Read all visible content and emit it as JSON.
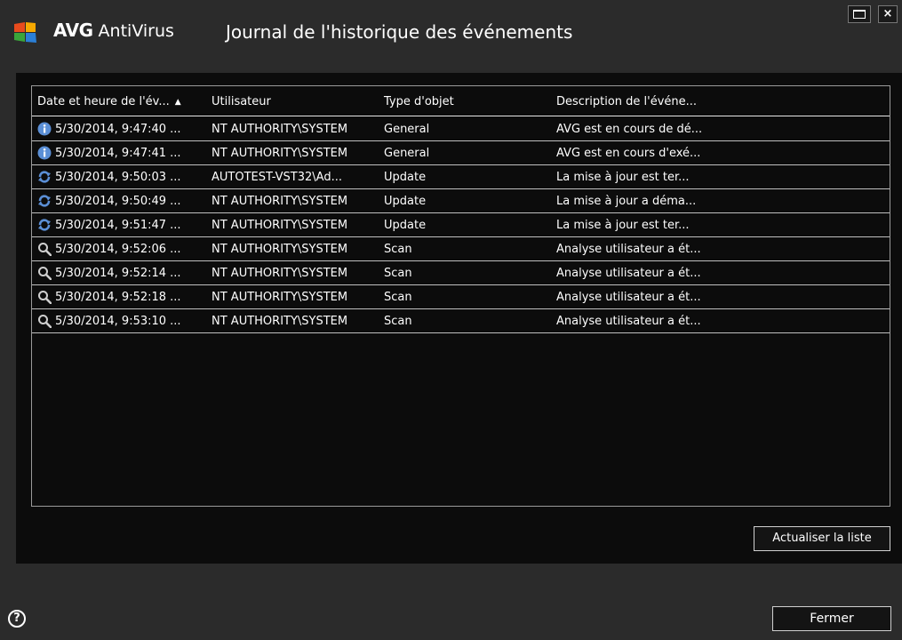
{
  "window": {
    "brand_bold": "AVG",
    "brand_rest": " AntiVirus",
    "title": "Journal de l'historique des événements",
    "close_glyph": "×"
  },
  "table": {
    "columns": [
      "Date et heure de l'év...",
      "Utilisateur",
      "Type d'objet",
      "Description de l'événe..."
    ],
    "sort_glyph": "▲",
    "rows": [
      {
        "icon": "info-icon",
        "date": "5/30/2014, 9:47:40 ...",
        "user": "NT AUTHORITY\\SYSTEM",
        "type": "General",
        "desc": "AVG est en cours de dé..."
      },
      {
        "icon": "info-icon",
        "date": "5/30/2014, 9:47:41 ...",
        "user": "NT AUTHORITY\\SYSTEM",
        "type": "General",
        "desc": "AVG est en cours d'exé..."
      },
      {
        "icon": "update-icon",
        "date": "5/30/2014, 9:50:03 ...",
        "user": "AUTOTEST-VST32\\Ad...",
        "type": "Update",
        "desc": "La mise à jour est ter..."
      },
      {
        "icon": "update-icon",
        "date": "5/30/2014, 9:50:49 ...",
        "user": "NT AUTHORITY\\SYSTEM",
        "type": "Update",
        "desc": "La mise à jour a déma..."
      },
      {
        "icon": "update-icon",
        "date": "5/30/2014, 9:51:47 ...",
        "user": "NT AUTHORITY\\SYSTEM",
        "type": "Update",
        "desc": "La mise à jour est ter..."
      },
      {
        "icon": "scan-icon",
        "date": "5/30/2014, 9:52:06 ...",
        "user": "NT AUTHORITY\\SYSTEM",
        "type": "Scan",
        "desc": "Analyse utilisateur a ét..."
      },
      {
        "icon": "scan-icon",
        "date": "5/30/2014, 9:52:14 ...",
        "user": "NT AUTHORITY\\SYSTEM",
        "type": "Scan",
        "desc": "Analyse utilisateur a ét..."
      },
      {
        "icon": "scan-icon",
        "date": "5/30/2014, 9:52:18 ...",
        "user": "NT AUTHORITY\\SYSTEM",
        "type": "Scan",
        "desc": "Analyse utilisateur a ét..."
      },
      {
        "icon": "scan-icon",
        "date": "5/30/2014, 9:53:10 ...",
        "user": "NT AUTHORITY\\SYSTEM",
        "type": "Scan",
        "desc": "Analyse utilisateur a ét..."
      }
    ]
  },
  "buttons": {
    "refresh": "Actualiser la liste",
    "close": "Fermer",
    "help": "?"
  },
  "colors": {
    "background": "#2b2b2b",
    "panel": "#0c0c0c",
    "info_icon": "#5b8fd6",
    "update_icon": "#5b8fd6",
    "scan_icon": "#cfcfcf"
  }
}
